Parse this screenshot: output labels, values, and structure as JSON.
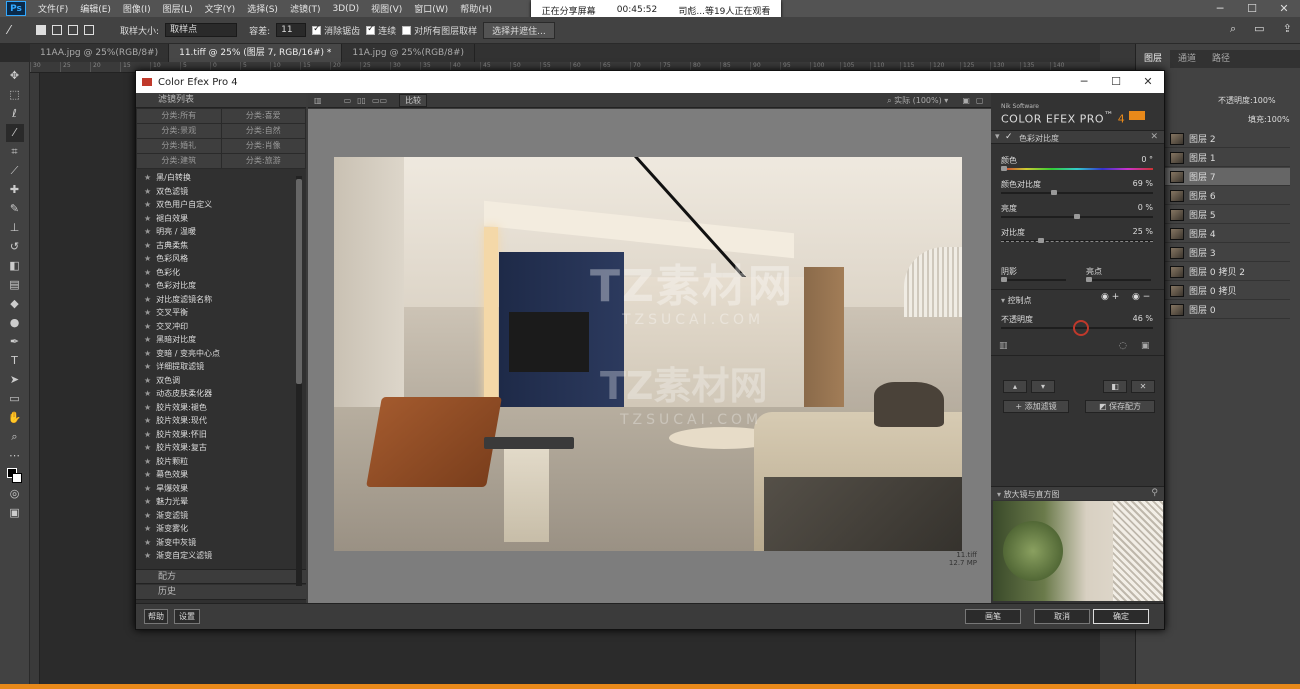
{
  "menubar": {
    "items": [
      "文件(F)",
      "编辑(E)",
      "图像(I)",
      "图层(L)",
      "文字(Y)",
      "选择(S)",
      "滤镜(T)",
      "3D(D)",
      "视图(V)",
      "窗口(W)",
      "帮助(H)"
    ],
    "logo": "Ps"
  },
  "share": {
    "status": "正在分享屏幕",
    "time": "00:45:52",
    "viewers": "司彪...等19人正在观看"
  },
  "options": {
    "sample_size_label": "取样大小:",
    "sample_size_value": "取样点",
    "tolerance_label": "容差:",
    "tolerance_value": "11",
    "antialias": "消除锯齿",
    "contiguous": "连续",
    "all_layers": "对所有图层取样",
    "select_mask": "选择并遮住..."
  },
  "tabs": [
    "11AA.jpg @ 25%(RGB/8#)",
    "11.tiff @ 25% (图层 7, RGB/16#) *",
    "11A.jpg @ 25%(RGB/8#)"
  ],
  "ruler": [
    "30",
    "25",
    "20",
    "15",
    "10",
    "5",
    "0",
    "5",
    "10",
    "15",
    "20",
    "25",
    "30",
    "35",
    "40",
    "45",
    "50",
    "55",
    "60",
    "65",
    "70",
    "75",
    "80",
    "85",
    "90",
    "95",
    "100",
    "105",
    "110",
    "115",
    "120",
    "125",
    "130",
    "135",
    "140"
  ],
  "panels": {
    "tabs": [
      "图层",
      "通道",
      "路径"
    ],
    "opacity_label": "不透明度:",
    "opacity_value": "100%",
    "fill_label": "填充:",
    "fill_value": "100%"
  },
  "layers": [
    "图层 2",
    "图层 1",
    "图层 7",
    "图层 6",
    "图层 5",
    "图层 4",
    "图层 3",
    "图层 0 拷贝 2",
    "图层 0 拷贝",
    "图层 0"
  ],
  "cef": {
    "title": "Color Efex Pro 4",
    "filter_list_header": "滤镜列表",
    "categories": [
      "分类:所有",
      "分类:喜爱",
      "分类:景观",
      "分类:自然",
      "分类:婚礼",
      "分类:肖像",
      "分类:建筑",
      "分类:旅游"
    ],
    "filters": [
      "黑/白转换",
      "双色滤镜",
      "双色用户自定义",
      "褪白效果",
      "明亮 / 温暖",
      "古典柔焦",
      "色彩风格",
      "色彩化",
      "色彩对比度",
      "对比度滤镜名称",
      "交叉平衡",
      "交叉冲印",
      "黑暗对比度",
      "变暗 / 变亮中心点",
      "详细提取滤镜",
      "双色调",
      "动态皮肤柔化器",
      "胶片效果:褪色",
      "胶片效果:现代",
      "胶片效果:怀旧",
      "胶片效果:复古",
      "胶片颗粒",
      "幕色效果",
      "旱爆效果",
      "魅力光晕",
      "渐变滤镜",
      "渐变雾化",
      "渐变中灰镜",
      "渐变自定义滤镜"
    ],
    "recipes": "配方",
    "history": "历史",
    "compare": "比较",
    "zoom": "实际 (100%)",
    "file_name": "11.tiff",
    "file_size": "12.7 MP",
    "brand_small": "Nik Software",
    "brand": "COLOR EFEX PRO",
    "brand_ver": "4",
    "active_filter": "色彩对比度",
    "sliders": [
      {
        "label": "颜色",
        "value": "0",
        "unit": "°",
        "pos": 0
      },
      {
        "label": "颜色对比度",
        "value": "69",
        "unit": "%",
        "pos": 0.34
      },
      {
        "label": "亮度",
        "value": "0",
        "unit": "%",
        "pos": 0.5
      },
      {
        "label": "对比度",
        "value": "25",
        "unit": "%",
        "pos": 0.25
      }
    ],
    "shadows": "阴影",
    "highlights": "亮点",
    "control_points": "控制点",
    "opacity_label": "不透明度",
    "opacity_value": "46",
    "opacity_unit": "%",
    "add_filter": "添加滤镜",
    "save_recipe": "保存配方",
    "loupe": "放大镜与直方图",
    "help": "帮助",
    "settings": "设置",
    "brush": "画笔",
    "cancel": "取消",
    "ok": "确定"
  },
  "watermark": {
    "logo": "TZ素材网",
    "url": "TZSUCAI.COM"
  }
}
